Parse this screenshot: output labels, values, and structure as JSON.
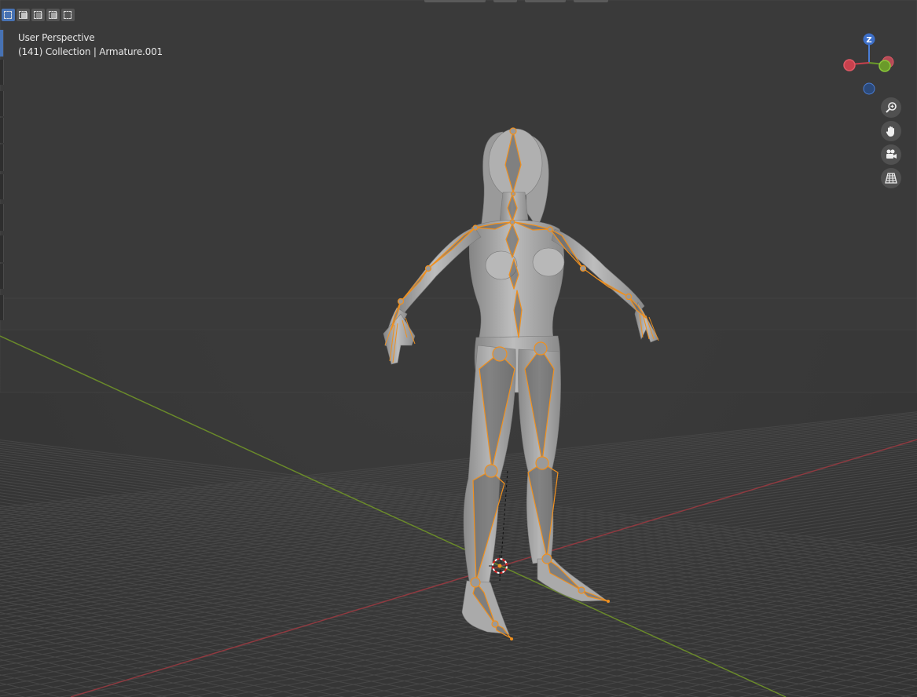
{
  "viewport": {
    "title": "User Perspective",
    "info": "(141) Collection | Armature.001"
  },
  "selection_modes": [
    "set",
    "extend",
    "subtract",
    "invert",
    "intersect"
  ],
  "navigation": {
    "axes": {
      "z_label": "Z"
    },
    "buttons": [
      "zoom-icon",
      "pan-hand-icon",
      "camera-icon",
      "perspective-grid-icon"
    ]
  },
  "colors": {
    "background": "#393939",
    "grid": "#474747",
    "x_axis": "#8e3a40",
    "y_axis": "#6a8a2a",
    "bone_outline": "#f0901e",
    "mesh": "#9a9a9a",
    "z_axis": "#4a7ed8"
  }
}
